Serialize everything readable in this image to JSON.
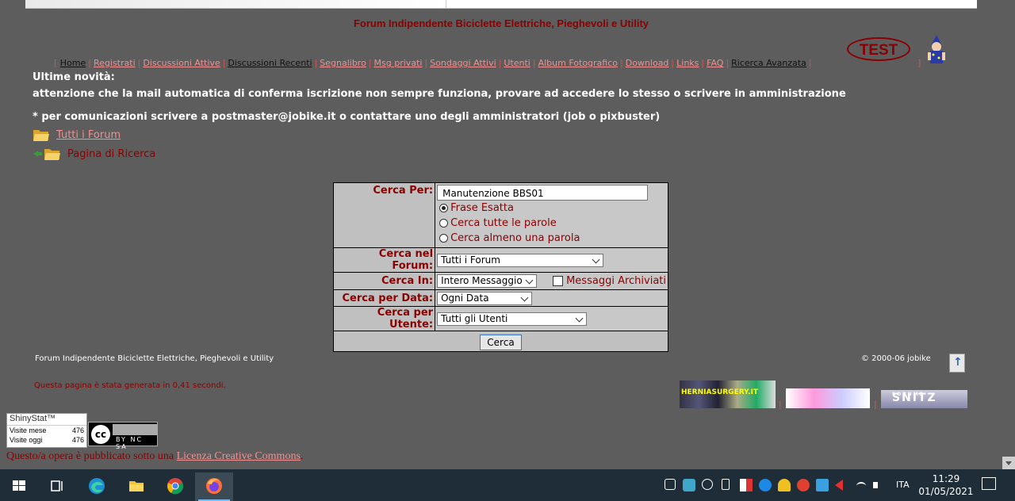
{
  "site": {
    "title": "Forum Indipendente Biciclette Elettriche, Pieghevoli e Utility",
    "test_logo": "TEST"
  },
  "nav": {
    "open_bracket": "[",
    "close_bracket": "]",
    "items": [
      {
        "label": "Home",
        "style": "dark"
      },
      {
        "label": "Registrati",
        "style": "link"
      },
      {
        "label": "Discussioni Attive",
        "style": "link"
      },
      {
        "label": "Discussioni Recenti",
        "style": "dark"
      },
      {
        "label": "Segnalibro",
        "style": "link"
      },
      {
        "label": "Msg privati",
        "style": "link"
      },
      {
        "label": "Sondaggi Attivi",
        "style": "link"
      },
      {
        "label": "Utenti",
        "style": "link"
      },
      {
        "label": "Album Fotografico",
        "style": "link"
      },
      {
        "label": "Download",
        "style": "link"
      },
      {
        "label": "Links",
        "style": "link"
      },
      {
        "label": "FAQ",
        "style": "link"
      },
      {
        "label": "Ricerca Avanzata",
        "style": "dark"
      }
    ]
  },
  "news": {
    "title": "Ultime novità:",
    "line1": "attenzione che la mail automatica di conferma iscrizione non sempre funziona, provare ad accedere lo stesso o scrivere in amministrazione",
    "line2": "* per comunicazioni scrivere a postmaster@jobike.it o contattare uno degli amministratori (job o pixbuster)"
  },
  "breadcrumb": {
    "all_forums": "Tutti i Forum",
    "search_page": "Pagina di Ricerca"
  },
  "search": {
    "search_for_label": "Cerca Per:",
    "search_value": "Manutenzione BBS01",
    "options": [
      {
        "label": "Frase Esatta",
        "checked": true
      },
      {
        "label": "Cerca tutte le parole",
        "checked": false
      },
      {
        "label": "Cerca almeno una parola",
        "checked": false
      }
    ],
    "forum_label": "Cerca nel Forum:",
    "forum_value": "Tutti i Forum",
    "in_label": "Cerca In:",
    "in_value": "Intero Messaggio",
    "archived_label": "Messaggi Archiviati",
    "archived_checked": false,
    "date_label": "Cerca per Data:",
    "date_value": "Ogni Data",
    "user_label": "Cerca per Utente:",
    "user_value": "Tutti gli Utenti",
    "submit_label": "Cerca"
  },
  "footer": {
    "site_name": "Forum Indipendente Biciclette Elettriche, Pieghevoli e Utility",
    "copyright": "© 2000-06 jobike",
    "generated": "Questa pagina è stata generata in 0,41 secondi.",
    "sponsor1": "HERNIASURGERY.IT",
    "sponsor3": "SNITZ",
    "sponsor3_sub": "FORUMS"
  },
  "stats": {
    "brand": "ShinyStat™",
    "month_label": "Visite mese",
    "month_value": "476",
    "today_label": "Visite oggi",
    "today_value": "476"
  },
  "license": {
    "cc_text": "BY NC SA",
    "prefix": "Questo/a opera è pubblicato sotto una ",
    "link": "Licenza Creative Commons",
    "suffix": "."
  },
  "taskbar": {
    "language": "ITA",
    "time": "11:29",
    "date": "01/05/2021"
  }
}
